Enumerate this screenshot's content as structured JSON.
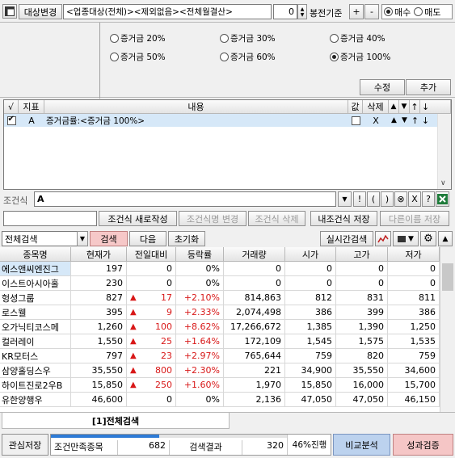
{
  "toolbar": {
    "target_change": "대상변경",
    "target_text": "<업종대상(전체)><제외없음><전체월결산>",
    "quantity": "0",
    "criteria_label": "봉전기준",
    "plus": "+",
    "minus": "-",
    "buy": "매수",
    "sell": "매도",
    "buy_selected": true
  },
  "margin_options": [
    {
      "label": "증거금 20%",
      "selected": false
    },
    {
      "label": "증거금 30%",
      "selected": false
    },
    {
      "label": "증거금 40%",
      "selected": false
    },
    {
      "label": "증거금 50%",
      "selected": false
    },
    {
      "label": "증거금 60%",
      "selected": false
    },
    {
      "label": "증거금 100%",
      "selected": true
    }
  ],
  "edit_buttons": {
    "modify": "수정",
    "add": "추가"
  },
  "condition_list": {
    "headers": {
      "check": "√",
      "index": "지표",
      "content": "내용",
      "value": "값",
      "delete": "삭제",
      "up": "▲",
      "down": "▼",
      "top": "↑",
      "bottom": "↓"
    },
    "rows": [
      {
        "checked": true,
        "index": "A",
        "content": "증거금률:<증거금 100%>",
        "value_checked": false,
        "delete": "X",
        "up": "▲",
        "down": "▼",
        "top": "↑",
        "bottom": "↓"
      }
    ]
  },
  "condition_expr": {
    "label": "조건식",
    "value": "A",
    "ops": [
      "!",
      "(",
      ")",
      "⊗",
      "X",
      "?"
    ]
  },
  "condition_buttons": {
    "new": "조건식 새로작성",
    "rename": "조건식명 변경",
    "delete": "조건식 삭제",
    "save": "내조건식 저장",
    "save_as": "다른이름 저장"
  },
  "search_bar": {
    "dropdown": "전체검색",
    "search": "검색",
    "next": "다음",
    "reset": "초기화",
    "realtime": "실시간검색"
  },
  "grid": {
    "headers": [
      "종목명",
      "현재가",
      "전일대비",
      "등락률",
      "거래량",
      "시가",
      "고가",
      "저가"
    ],
    "rows": [
      {
        "name": "에스앤씨엔진그",
        "price": "197",
        "change": "0",
        "up": false,
        "rate": "0%",
        "volume": "0",
        "open": "0",
        "high": "0",
        "low": "0",
        "highlight": true
      },
      {
        "name": "이스트아시아홀",
        "price": "230",
        "change": "0",
        "up": false,
        "rate": "0%",
        "volume": "0",
        "open": "0",
        "high": "0",
        "low": "0",
        "highlight": false
      },
      {
        "name": "헝셩그룹",
        "price": "827",
        "change": "17",
        "up": true,
        "rate": "+2.10%",
        "volume": "814,863",
        "open": "812",
        "high": "831",
        "low": "811",
        "highlight": false
      },
      {
        "name": "로스웰",
        "price": "395",
        "change": "9",
        "up": true,
        "rate": "+2.33%",
        "volume": "2,074,498",
        "open": "386",
        "high": "399",
        "low": "386",
        "highlight": false
      },
      {
        "name": "오가닉티코스메",
        "price": "1,260",
        "change": "100",
        "up": true,
        "rate": "+8.62%",
        "volume": "17,266,672",
        "open": "1,385",
        "high": "1,390",
        "low": "1,250",
        "highlight": false
      },
      {
        "name": "컬러레이",
        "price": "1,550",
        "change": "25",
        "up": true,
        "rate": "+1.64%",
        "volume": "172,109",
        "open": "1,545",
        "high": "1,575",
        "low": "1,535",
        "highlight": false
      },
      {
        "name": "KR모터스",
        "price": "797",
        "change": "23",
        "up": true,
        "rate": "+2.97%",
        "volume": "765,644",
        "open": "759",
        "high": "820",
        "low": "759",
        "highlight": false
      },
      {
        "name": "삼양홀딩스우",
        "price": "35,550",
        "change": "800",
        "up": true,
        "rate": "+2.30%",
        "volume": "221",
        "open": "34,900",
        "high": "35,550",
        "low": "34,600",
        "highlight": false
      },
      {
        "name": "하이트진로2우B",
        "price": "15,850",
        "change": "250",
        "up": true,
        "rate": "+1.60%",
        "volume": "1,970",
        "open": "15,850",
        "high": "16,000",
        "low": "15,700",
        "highlight": false
      },
      {
        "name": "유한양행우",
        "price": "46,600",
        "change": "0",
        "up": false,
        "rate": "0%",
        "volume": "2,136",
        "open": "47,050",
        "high": "47,050",
        "low": "46,150",
        "highlight": false
      }
    ]
  },
  "result_tab": "[1]전체검색",
  "status": {
    "save_interest": "관심저장",
    "matched_label": "조건만족종목",
    "matched_count": "682",
    "result_label": "검색결과",
    "result_count": "320",
    "progress_text": "46%진행",
    "progress_fraction": 0.46,
    "compare": "비교분석",
    "performance": "성과검증"
  },
  "colors": {
    "up": "#d81818",
    "search_btn": "#f6c8c8",
    "compare_btn": "#bcd2ee",
    "performance_btn": "#f5c6c6",
    "progress": "#2e7bd6",
    "highlight_row": "#d6e8f8"
  }
}
